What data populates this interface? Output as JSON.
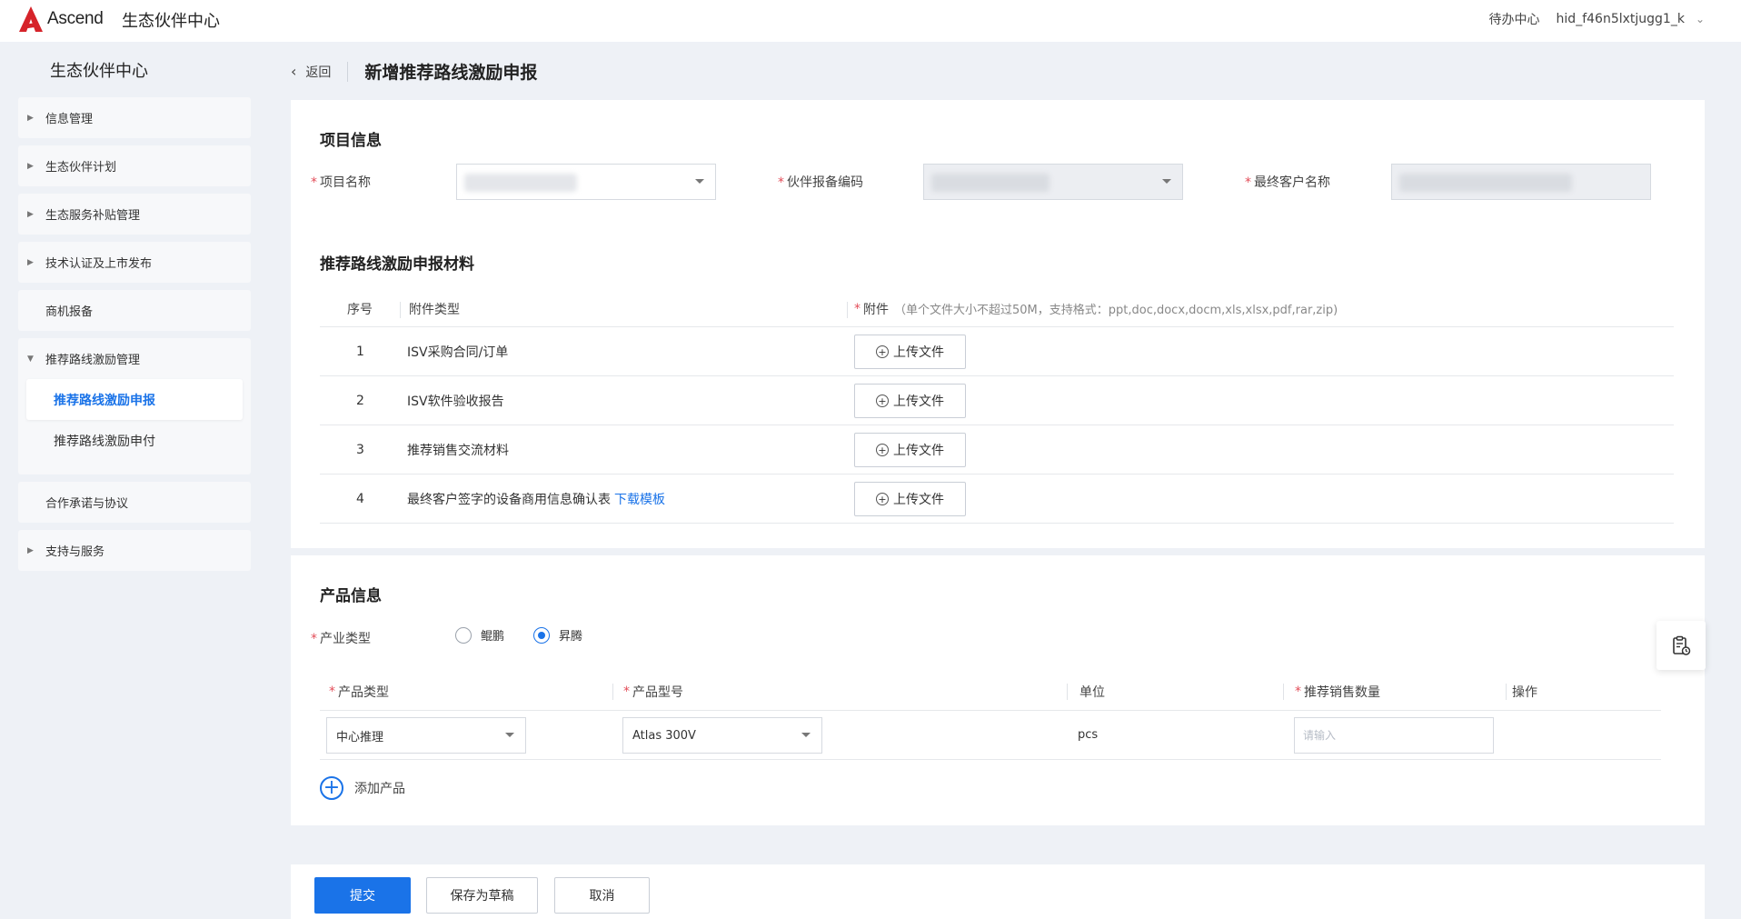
{
  "app": {
    "logo_text": "Ascend",
    "title": "生态伙伴中心"
  },
  "topbar": {
    "todo_label": "待办中心",
    "username": "hid_f46n5lxtjugg1_k"
  },
  "sidebar": {
    "title": "生态伙伴中心",
    "items": [
      {
        "label": "信息管理"
      },
      {
        "label": "生态伙伴计划"
      },
      {
        "label": "生态服务补贴管理"
      },
      {
        "label": "技术认证及上市发布"
      },
      {
        "label": "商机报备"
      },
      {
        "label": "推荐路线激励管理",
        "expanded": true,
        "children": [
          "推荐路线激励申报",
          "推荐路线激励申付"
        ],
        "active_child": "推荐路线激励申报"
      },
      {
        "label": "合作承诺与协议"
      },
      {
        "label": "支持与服务"
      }
    ]
  },
  "header": {
    "back_label": "返回",
    "page_title": "新增推荐路线激励申报"
  },
  "project_info": {
    "section_title": "项目信息",
    "project_name_label": "项目名称",
    "partner_code_label": "伙伴报备编码",
    "end_customer_label": "最终客户名称"
  },
  "materials": {
    "section_title": "推荐路线激励申报材料",
    "col_index": "序号",
    "col_type": "附件类型",
    "col_attachment": "附件",
    "attachment_hint": "（单个文件大小不超过50M，支持格式：ppt,doc,docx,docm,xls,xlsx,pdf,rar,zip)",
    "upload_label": "上传文件",
    "download_template": "下载模板",
    "rows": [
      {
        "index": "1",
        "type": "ISV采购合同/订单"
      },
      {
        "index": "2",
        "type": "ISV软件验收报告"
      },
      {
        "index": "3",
        "type": "推荐销售交流材料"
      },
      {
        "index": "4",
        "type": "最终客户签字的设备商用信息确认表"
      }
    ]
  },
  "product_info": {
    "section_title": "产品信息",
    "industry_label": "产业类型",
    "industry_options": [
      "鲲鹏",
      "昇腾"
    ],
    "industry_selected": "昇腾",
    "columns": {
      "product_type": "产品类型",
      "product_model": "产品型号",
      "unit": "单位",
      "quantity": "推荐销售数量",
      "action": "操作"
    },
    "row": {
      "product_type": "中心推理",
      "product_model": "Atlas 300V",
      "unit": "pcs",
      "quantity_placeholder": "请输入"
    },
    "add_label": "添加产品"
  },
  "footer": {
    "submit": "提交",
    "save_draft": "保存为草稿",
    "cancel": "取消"
  },
  "colors": {
    "accent": "#1a73e8",
    "required": "#e34d59",
    "logo_red": "#d6232a",
    "background": "#eef1f6"
  }
}
